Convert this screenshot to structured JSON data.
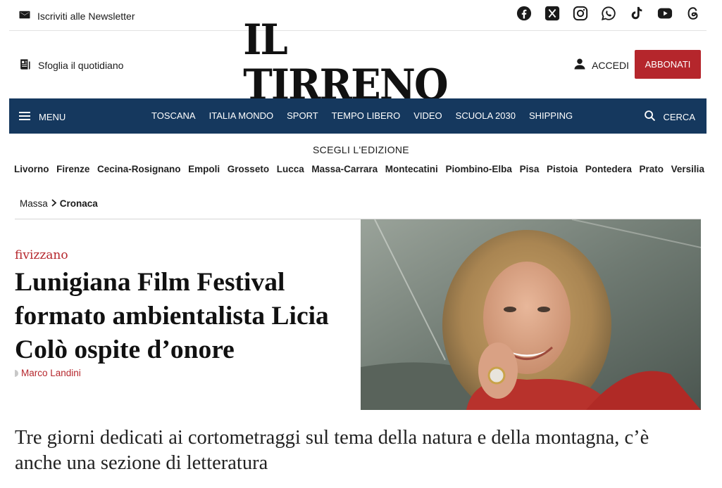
{
  "topbar": {
    "newsletter_label": "Iscriviti alle Newsletter",
    "newsletter_icon": "mail-icon",
    "socials": [
      "facebook-icon",
      "x-icon",
      "instagram-icon",
      "whatsapp-icon",
      "tiktok-icon",
      "youtube-icon",
      "threads-icon"
    ]
  },
  "header": {
    "sfoglia_label": "Sfoglia il quotidiano",
    "logo_text": "IL TIRRENO",
    "login_label": "ACCEDI",
    "subscribe_label": "ABBONATI",
    "accent_color": "#b5262c"
  },
  "nav": {
    "menu_label": "MENU",
    "links": [
      "TOSCANA",
      "ITALIA MONDO",
      "SPORT",
      "TEMPO LIBERO",
      "VIDEO",
      "SCUOLA 2030",
      "SHIPPING"
    ],
    "search_label": "CERCA",
    "background_color": "#15385e"
  },
  "editions": {
    "title": "SCEGLI L'EDIZIONE",
    "items": [
      "Livorno",
      "Firenze",
      "Cecina-Rosignano",
      "Empoli",
      "Grosseto",
      "Lucca",
      "Massa-Carrara",
      "Montecatini",
      "Piombino-Elba",
      "Pisa",
      "Pistoia",
      "Pontedera",
      "Prato",
      "Versilia"
    ]
  },
  "breadcrumb": {
    "parent": "Massa",
    "current": "Cronaca"
  },
  "article": {
    "kicker": "fivizzano",
    "headline": "Lunigiana Film Festival formato ambientalista Licia Colò ospite d’onore",
    "author": "Marco Landini",
    "subtitle": "Tre giorni dedicati ai cortometraggi sul tema della natura e della montagna, c’è anche una sezione di letteratura"
  }
}
